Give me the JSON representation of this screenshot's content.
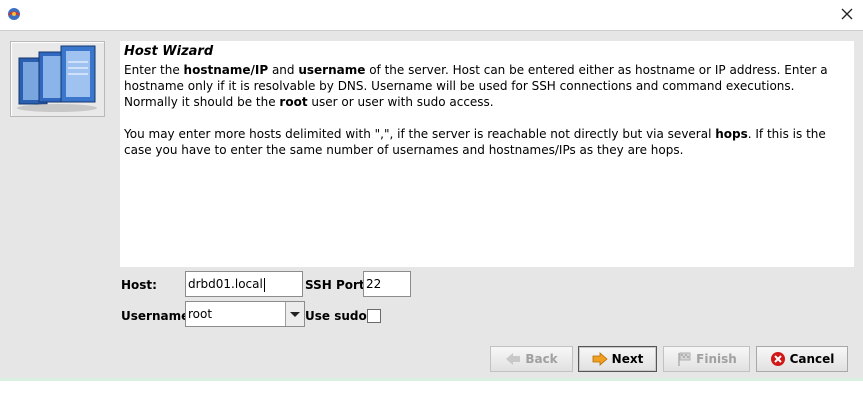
{
  "window": {
    "title": "",
    "close_label": "Close"
  },
  "wizard": {
    "title": "Host Wizard",
    "paragraph1": {
      "t1": "Enter the ",
      "b1": "hostname/IP",
      "t2": " and ",
      "b2": "username",
      "t3": " of the server. Host can be entered either as hostname or IP address. Enter a hostname only if it is resolvable by DNS. Username will be used for SSH connections and command executions. Normally it should be the ",
      "b3": "root",
      "t4": " user or user with sudo access."
    },
    "paragraph2": {
      "t1": "You may enter more hosts delimited with \",\", if the server is reachable not directly but via several ",
      "b1": "hops",
      "t2": ". If this is the case you have to enter the same number of usernames and hostnames/IPs as they are hops."
    }
  },
  "form": {
    "host_label": "Host:",
    "host_value": "drbd01.local",
    "ssh_port_label": "SSH Port:",
    "ssh_port_value": "22",
    "username_label": "Username:",
    "username_value": "root",
    "use_sudo_label": "Use sudo:",
    "use_sudo_checked": false
  },
  "buttons": {
    "back": "Back",
    "next": "Next",
    "finish": "Finish",
    "cancel": "Cancel"
  },
  "icons": {
    "app": "app-logo-icon",
    "close": "close-icon",
    "back": "back-arrow-icon",
    "next": "next-arrow-icon",
    "finish": "finish-flag-icon",
    "cancel": "cancel-icon",
    "combo": "chevron-down-icon"
  },
  "colors": {
    "dialog_bg": "#e6e6e6",
    "next_arrow": "#f0a020",
    "cancel_red": "#d01818"
  }
}
